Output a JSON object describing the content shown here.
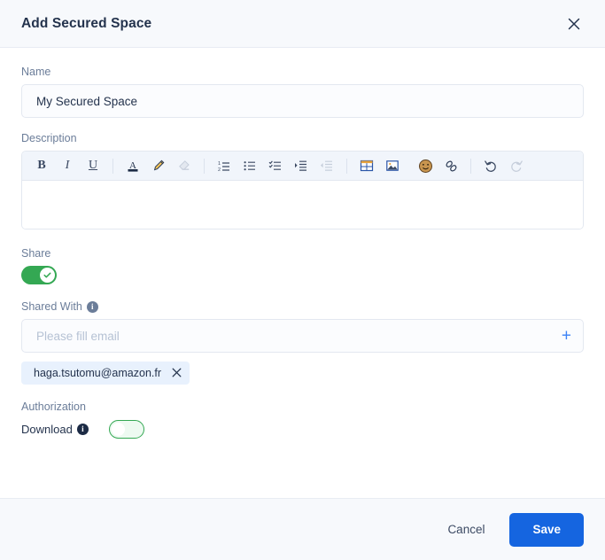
{
  "dialog": {
    "title": "Add Secured Space",
    "close_icon": "close-icon"
  },
  "name_field": {
    "label": "Name",
    "value": "My Secured Space",
    "placeholder": ""
  },
  "description_field": {
    "label": "Description",
    "content": "",
    "toolbar": [
      {
        "name": "bold-icon",
        "glyph": "B",
        "disabled": false
      },
      {
        "name": "italic-icon",
        "glyph": "I",
        "disabled": false
      },
      {
        "name": "underline-icon",
        "glyph": "U",
        "disabled": false
      },
      {
        "name": "text-color-icon",
        "glyph": "A",
        "disabled": false
      },
      {
        "name": "highlighter-icon",
        "glyph": "pen",
        "disabled": false
      },
      {
        "name": "clear-format-icon",
        "glyph": "eraser",
        "disabled": true
      },
      {
        "name": "ordered-list-icon",
        "glyph": "list-numbered",
        "disabled": false
      },
      {
        "name": "bullet-list-icon",
        "glyph": "list-bullet",
        "disabled": false
      },
      {
        "name": "checklist-icon",
        "glyph": "list-check",
        "disabled": false
      },
      {
        "name": "indent-icon",
        "glyph": "indent",
        "disabled": false
      },
      {
        "name": "outdent-icon",
        "glyph": "outdent",
        "disabled": true
      },
      {
        "name": "table-icon",
        "glyph": "table",
        "disabled": false
      },
      {
        "name": "image-icon",
        "glyph": "image",
        "disabled": false
      },
      {
        "name": "emoji-icon",
        "glyph": "emoji",
        "disabled": false
      },
      {
        "name": "link-icon",
        "glyph": "link",
        "disabled": false
      },
      {
        "name": "undo-icon",
        "glyph": "undo",
        "disabled": false
      },
      {
        "name": "redo-icon",
        "glyph": "redo",
        "disabled": true
      }
    ]
  },
  "share": {
    "label": "Share",
    "enabled": true,
    "state_text": "on"
  },
  "shared_with": {
    "label": "Shared With",
    "info_icon": "info-icon",
    "placeholder": "Please fill email",
    "value": "",
    "add_icon": "plus-icon",
    "chips": [
      {
        "email": "haga.tsutomu@amazon.fr",
        "remove_icon": "close-icon"
      }
    ]
  },
  "authorization": {
    "label": "Authorization",
    "items": [
      {
        "label": "Download",
        "info_icon": "info-icon",
        "enabled": false,
        "state_text": "off"
      }
    ]
  },
  "footer": {
    "cancel_label": "Cancel",
    "save_label": "Save"
  },
  "colors": {
    "accent_blue": "#1565e0",
    "toggle_green": "#34a853",
    "chip_bg": "#e8f1fd",
    "panel_bg": "#f7f9fc",
    "toolbar_bg": "#f1f5fb"
  }
}
